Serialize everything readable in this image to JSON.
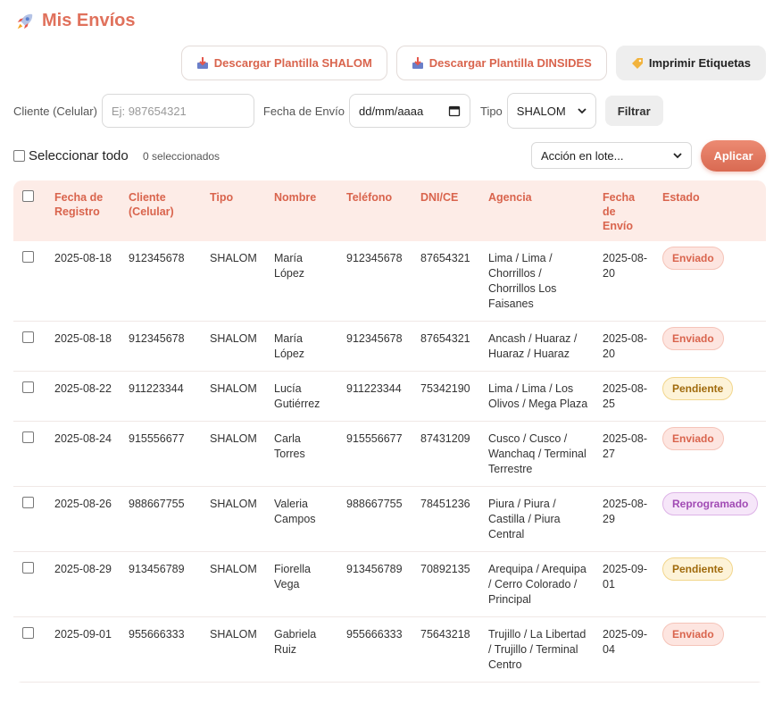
{
  "header": {
    "title": "Mis Envíos",
    "icon": "rocket-icon"
  },
  "actions": {
    "download_shalom": "Descargar Plantilla SHALOM",
    "download_dinsides": "Descargar Plantilla DINSIDES",
    "print_labels": "Imprimir Etiquetas"
  },
  "filters": {
    "client_label": "Cliente (Celular)",
    "client_placeholder": "Ej: 987654321",
    "date_label": "Fecha de Envío",
    "date_value": "dd/mm/aaaa",
    "type_label": "Tipo",
    "type_value": "SHALOM",
    "filter_button": "Filtrar"
  },
  "bulk": {
    "select_all": "Seleccionar todo",
    "selected_count": "0 seleccionados",
    "action_placeholder": "Acción en lote...",
    "apply": "Aplicar"
  },
  "table": {
    "columns": [
      "Fecha de Registro",
      "Cliente (Celular)",
      "Tipo",
      "Nombre",
      "Teléfono",
      "DNI/CE",
      "Agencia",
      "Fecha de Envío",
      "Estado"
    ],
    "rows": [
      {
        "registro": "2025-08-18",
        "cliente": "912345678",
        "tipo": "SHALOM",
        "nombre": "María López",
        "telefono": "912345678",
        "dni": "87654321",
        "agencia": "Lima / Lima / Chorrillos / Chorrillos Los Faisanes",
        "envio": "2025-08-20",
        "estado": "Enviado"
      },
      {
        "registro": "2025-08-18",
        "cliente": "912345678",
        "tipo": "SHALOM",
        "nombre": "María López",
        "telefono": "912345678",
        "dni": "87654321",
        "agencia": "Ancash / Huaraz / Huaraz / Huaraz",
        "envio": "2025-08-20",
        "estado": "Enviado"
      },
      {
        "registro": "2025-08-22",
        "cliente": "911223344",
        "tipo": "SHALOM",
        "nombre": "Lucía Gutiérrez",
        "telefono": "911223344",
        "dni": "75342190",
        "agencia": "Lima / Lima / Los Olivos / Mega Plaza",
        "envio": "2025-08-25",
        "estado": "Pendiente"
      },
      {
        "registro": "2025-08-24",
        "cliente": "915556677",
        "tipo": "SHALOM",
        "nombre": "Carla Torres",
        "telefono": "915556677",
        "dni": "87431209",
        "agencia": "Cusco / Cusco / Wanchaq / Terminal Terrestre",
        "envio": "2025-08-27",
        "estado": "Enviado"
      },
      {
        "registro": "2025-08-26",
        "cliente": "988667755",
        "tipo": "SHALOM",
        "nombre": "Valeria Campos",
        "telefono": "988667755",
        "dni": "78451236",
        "agencia": "Piura / Piura / Castilla / Piura Central",
        "envio": "2025-08-29",
        "estado": "Reprogramado"
      },
      {
        "registro": "2025-08-29",
        "cliente": "913456789",
        "tipo": "SHALOM",
        "nombre": "Fiorella Vega",
        "telefono": "913456789",
        "dni": "70892135",
        "agencia": "Arequipa / Arequipa / Cerro Colorado / Principal",
        "envio": "2025-09-01",
        "estado": "Pendiente"
      },
      {
        "registro": "2025-09-01",
        "cliente": "955666333",
        "tipo": "SHALOM",
        "nombre": "Gabriela Ruiz",
        "telefono": "955666333",
        "dni": "75643218",
        "agencia": "Trujillo / La Libertad / Trujillo / Terminal Centro",
        "envio": "2025-09-04",
        "estado": "Enviado"
      }
    ]
  },
  "status_colors": {
    "Enviado": "#d9644d",
    "Pendiente": "#a06a0c",
    "Reprogramado": "#a14bb4"
  }
}
